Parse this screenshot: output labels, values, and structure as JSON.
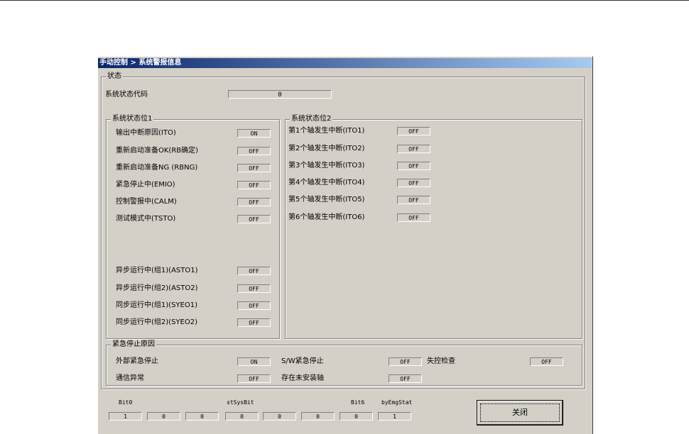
{
  "title": "手动控制 > 系统警报信息",
  "status_group": "状态",
  "status_code": {
    "label": "系统状态代码",
    "value": "0"
  },
  "group1": {
    "title": "系统状态位1",
    "items": [
      {
        "label": "输出中断原因(ITO)",
        "value": "ON"
      },
      {
        "label": "重新启动准备OK(RB确定)",
        "value": "OFF"
      },
      {
        "label": "重新启动准备NG (RBNG)",
        "value": "OFF"
      },
      {
        "label": "紧急停止中(EMIO)",
        "value": "OFF"
      },
      {
        "label": "控制警报中(CALM)",
        "value": "OFF"
      },
      {
        "label": "测试模式中(TSTO)",
        "value": "OFF"
      },
      {
        "label": "异步运行中(组1)(ASTO1)",
        "value": "OFF"
      },
      {
        "label": "异步运行中(组2)(ASTO2)",
        "value": "OFF"
      },
      {
        "label": "同步运行中(组1)(SYEO1)",
        "value": "OFF"
      },
      {
        "label": "同步运行中(组2)(SYEO2)",
        "value": "OFF"
      }
    ]
  },
  "group2": {
    "title": "系统状态位2",
    "items": [
      {
        "label": "第1个轴发生中断(ITO1)",
        "value": "OFF"
      },
      {
        "label": "第2个轴发生中断(ITO2)",
        "value": "OFF"
      },
      {
        "label": "第3个轴发生中断(ITO3)",
        "value": "OFF"
      },
      {
        "label": "第4个轴发生中断(ITO4)",
        "value": "OFF"
      },
      {
        "label": "第5个轴发生中断(ITO5)",
        "value": "OFF"
      },
      {
        "label": "第6个轴发生中断(ITO6)",
        "value": "OFF"
      }
    ]
  },
  "emergency": {
    "title": "紧急停止原因",
    "items": [
      {
        "label": "外部紧急停止",
        "value": "ON"
      },
      {
        "label": "S/W紧急停止",
        "value": "OFF"
      },
      {
        "label": "失控检查",
        "value": "OFF"
      },
      {
        "label": "通信异常",
        "value": "OFF"
      },
      {
        "label": "存在未安装轴",
        "value": "OFF"
      }
    ]
  },
  "bits": {
    "labels": [
      "Bit0",
      "stSysBit",
      "Bit6",
      "byEmgStat"
    ],
    "values": [
      "1",
      "0",
      "0",
      "0",
      "0",
      "0",
      "0",
      "1"
    ]
  },
  "close_label": "关闭"
}
